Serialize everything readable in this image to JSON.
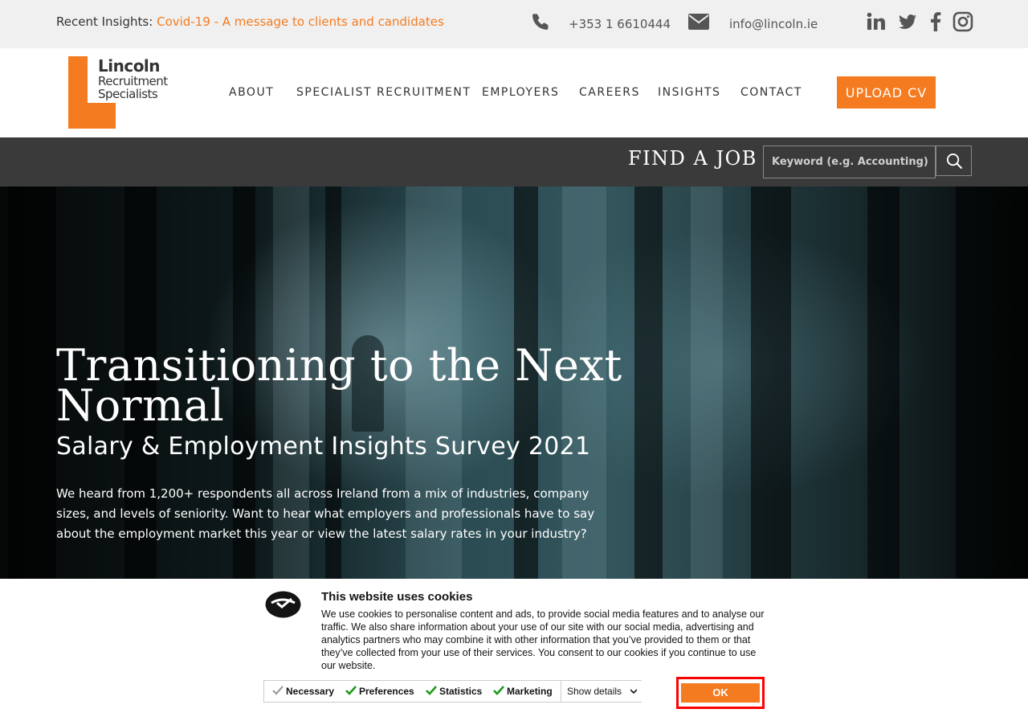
{
  "topbar": {
    "insights_label": "Recent Insights:",
    "insights_link": "Covid-19 - A message to clients and candidates",
    "phone": "+353 1 6610444",
    "email": "info@lincoln.ie",
    "social_icons": [
      "linkedin-icon",
      "twitter-icon",
      "facebook-icon",
      "instagram-icon"
    ]
  },
  "logo": {
    "line1": "Lincoln",
    "line2": "Recruitment",
    "line3": "Specialists"
  },
  "nav": {
    "items": [
      {
        "label": "ABOUT"
      },
      {
        "label": "SPECIALIST RECRUITMENT"
      },
      {
        "label": "EMPLOYERS"
      },
      {
        "label": "CAREERS"
      },
      {
        "label": "INSIGHTS"
      },
      {
        "label": "CONTACT"
      }
    ],
    "upload_label": "UPLOAD CV"
  },
  "find_job": {
    "title": "FIND A JOB",
    "placeholder": "Keyword (e.g. Accounting)"
  },
  "hero": {
    "title": "Transitioning to the Next Normal",
    "subtitle": "Salary & Employment Insights Survey 2021",
    "body": "We heard from 1,200+ respondents all across Ireland from a mix of industries, company sizes, and levels of seniority. Want to hear what employers and professionals have to say about the employment market this year or view the latest salary rates in your industry?"
  },
  "cookie": {
    "title": "This website uses cookies",
    "text": "We use cookies to personalise content and ads, to provide social media features and to analyse our traffic. We also share information about your use of our site with our social media, advertising and analytics partners who may combine it with other information that you’ve provided to them or that they’ve collected from your use of their services. You consent to our cookies if you continue to use our website.",
    "options": [
      {
        "label": "Necessary",
        "checked": true,
        "disabled": true
      },
      {
        "label": "Preferences",
        "checked": true
      },
      {
        "label": "Statistics",
        "checked": true
      },
      {
        "label": "Marketing",
        "checked": true
      }
    ],
    "details_label": "Show details",
    "ok_label": "OK"
  },
  "colors": {
    "accent": "#f47b20",
    "dark_bar": "#3a3a3a",
    "topbar_bg": "#f0f0f0",
    "highlight": "#ff0000"
  }
}
